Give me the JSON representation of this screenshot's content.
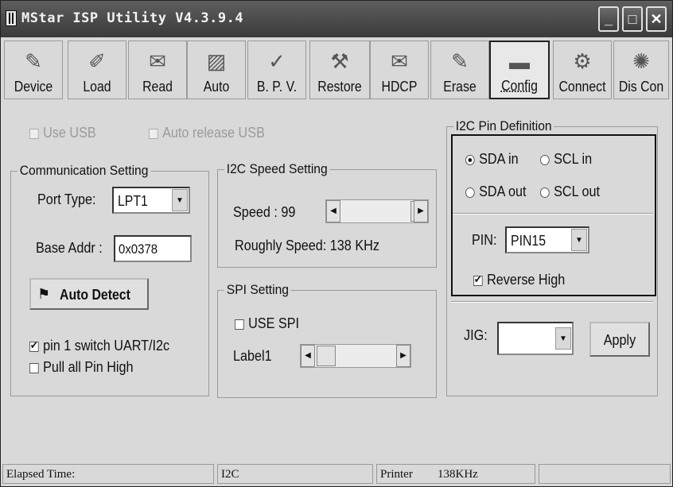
{
  "window": {
    "title": "MStar ISP Utility V4.3.9.4",
    "controls": {
      "minimize": "_",
      "maximize": "□",
      "close": "✕"
    }
  },
  "toolbar": {
    "items": [
      {
        "id": "device",
        "label": "Device",
        "icon": "device-icon",
        "glyph": "✎"
      },
      {
        "id": "load",
        "label": "Load",
        "icon": "load-icon",
        "glyph": "✐"
      },
      {
        "id": "read",
        "label": "Read",
        "icon": "read-icon",
        "glyph": "✉"
      },
      {
        "id": "auto",
        "label": "Auto",
        "icon": "auto-icon",
        "glyph": "▨"
      },
      {
        "id": "bpv",
        "label": "B. P. V.",
        "icon": "bpv-icon",
        "glyph": "✓"
      },
      {
        "id": "restore",
        "label": "Restore",
        "icon": "restore-icon",
        "glyph": "⚒"
      },
      {
        "id": "hdcp",
        "label": "HDCP",
        "icon": "hdcp-icon",
        "glyph": "✉"
      },
      {
        "id": "erase",
        "label": "Erase",
        "icon": "erase-icon",
        "glyph": "✎"
      },
      {
        "id": "config",
        "label": "Config",
        "icon": "config-icon",
        "glyph": "▬",
        "active": true
      },
      {
        "id": "connect",
        "label": "Connect",
        "icon": "connect-icon",
        "glyph": "⚙"
      },
      {
        "id": "disconnect",
        "label": "Dis Con",
        "icon": "disconnect-icon",
        "glyph": "✺"
      }
    ]
  },
  "options": {
    "use_usb": "Use USB",
    "auto_release_usb": "Auto release USB"
  },
  "communication": {
    "title": "Communication Setting",
    "port_type_label": "Port Type:",
    "port_type_value": "LPT1",
    "base_addr_label": "Base Addr :",
    "base_addr_value": "0x0378",
    "auto_detect": "Auto Detect",
    "pin1_switch": "pin 1 switch UART/I2c",
    "pin1_switch_checked": true,
    "pull_all_high": "Pull all Pin High",
    "pull_all_high_checked": false
  },
  "i2c_speed": {
    "title": "I2C Speed Setting",
    "speed_label": "Speed : 99",
    "roughly_label": "Roughly Speed: 138 KHz",
    "slider_value": 99
  },
  "spi": {
    "title": "SPI Setting",
    "use_spi": "USE SPI",
    "use_spi_checked": false,
    "label1": "Label1"
  },
  "i2c_pin": {
    "title": "I2C Pin Definition",
    "sda_in": "SDA in",
    "scl_in": "SCL in",
    "sda_out": "SDA out",
    "scl_out": "SCL out",
    "selected": "SDA in",
    "pin_label": "PIN:",
    "pin_value": "PIN15",
    "reverse_high": "Reverse High",
    "reverse_high_checked": true
  },
  "jig": {
    "label": "JIG:",
    "value": "",
    "apply": "Apply"
  },
  "status": {
    "elapsed": "Elapsed Time:",
    "mode": "I2C",
    "printer": "Printer",
    "speed": "138KHz"
  }
}
